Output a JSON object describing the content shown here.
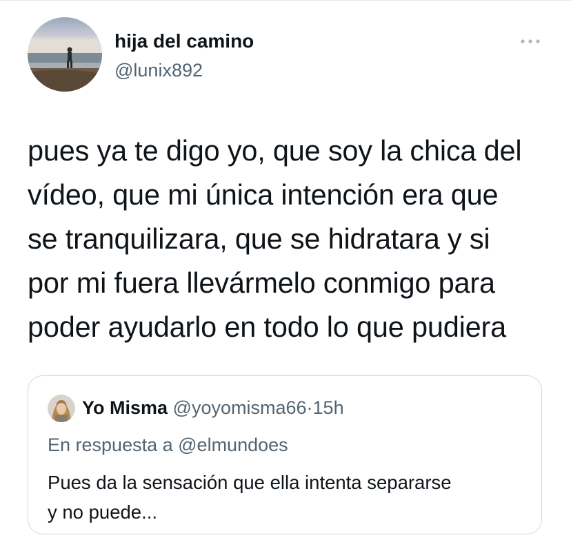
{
  "tweet": {
    "author": {
      "display_name": "hija del camino",
      "handle": "@lunix892",
      "avatar_icon": "profile-photo-beach"
    },
    "more_icon": "ellipsis-icon",
    "text_lines": [
      "pues ya te digo yo, que soy la chica del",
      "vídeo, que mi única intención era que",
      "se tranquilizara, que se hidratara y si",
      "por mi fuera llevármelo conmigo para",
      "poder ayudarlo en todo lo que pudiera"
    ]
  },
  "quote": {
    "display_name": "Yo Misma",
    "handle": "@yoyomisma66",
    "separator": "·",
    "time": "15h",
    "avatar_icon": "profile-photo-woman",
    "reply_prefix": "En respuesta a",
    "reply_mention": "@elmundoes",
    "text_lines": [
      "Pues da la sensación que ella intenta separarse",
      "y no puede..."
    ]
  },
  "colors": {
    "text_primary": "#0f1419",
    "text_secondary": "#536471",
    "border": "#cfd9de"
  }
}
